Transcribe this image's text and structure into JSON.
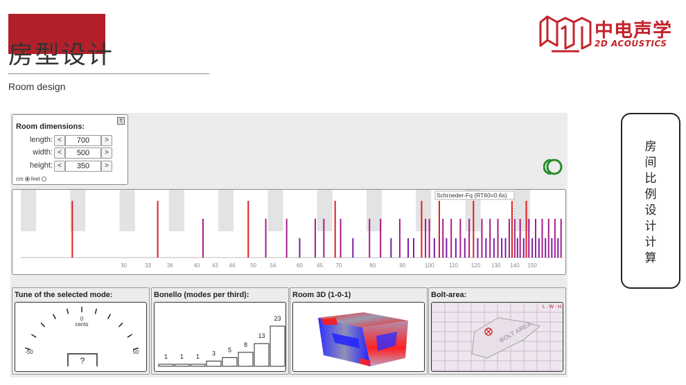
{
  "slide": {
    "title": "房型设计",
    "subtitle": "Room design"
  },
  "logo": {
    "cn": "中电声学",
    "en": "2D ACOUSTICS"
  },
  "room_dimensions": {
    "title": "Room dimensions:",
    "collapse_glyph": "⇑",
    "fields": [
      {
        "label": "length:",
        "value": "700"
      },
      {
        "label": "width:",
        "value": "500"
      },
      {
        "label": "height:",
        "value": "350"
      }
    ],
    "prev_glyph": "<",
    "next_glyph": ">",
    "units": {
      "cm": "cm",
      "feet": "feet",
      "selected": "cm"
    }
  },
  "modes": {
    "schroeder_label": "Schroeder-Fq (RT60=0.6s)",
    "x_ticks": [
      "30",
      "33",
      "36",
      "40",
      "43",
      "46",
      "50",
      "54",
      "60",
      "65",
      "70",
      "80",
      "90",
      "100",
      "110",
      "120",
      "130",
      "140",
      "150"
    ],
    "colors": {
      "axial": "#e01a1a",
      "tangential": "#a8198a",
      "oblique": "#7a1aa8"
    }
  },
  "tune_panel": {
    "title": "Tune of the selected mode:",
    "zero_label": "0",
    "unit_label": "cents",
    "min_label": "-50",
    "max_label": "50",
    "value": "?"
  },
  "bonello_panel": {
    "title": "Bonello (modes per third):",
    "values": [
      1,
      1,
      1,
      3,
      5,
      8,
      13,
      23
    ]
  },
  "room3d_panel": {
    "title": "Room 3D (1-0-1)"
  },
  "bolt_panel": {
    "title": "Bolt-area:",
    "ratio_label": "L : W : H",
    "area_label": "BOLT AREA"
  },
  "side_card": {
    "chars": [
      "房",
      "间",
      "比",
      "例",
      "设",
      "计",
      "计",
      "算"
    ]
  }
}
